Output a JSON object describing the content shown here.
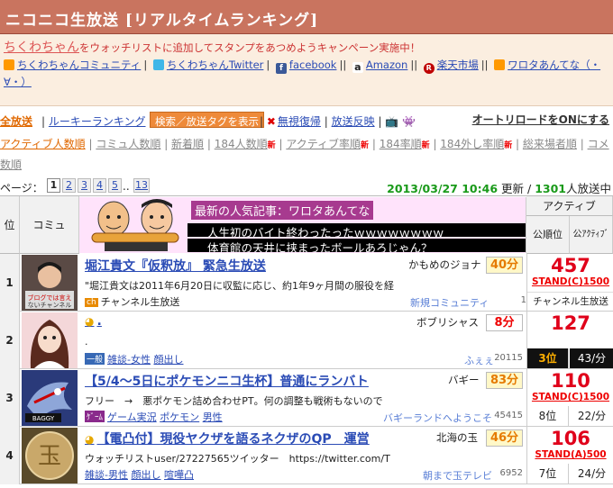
{
  "header": {
    "title": "ニコニコ生放送 [リアルタイムランキング]"
  },
  "promo": {
    "campaign_name": "ちくわちゃん",
    "campaign_text": "をウォッチリストに追加してスタンプをあつめようキャンペーン実施中！",
    "links": [
      "ちくわちゃんコミュニティ",
      "ちくわちゃんTwitter",
      "facebook",
      "Amazon",
      "楽天市場",
      "ワロタあんてな（・∀・）"
    ]
  },
  "nav": {
    "all": "全放送",
    "rookie": "ルーキーランキング",
    "tag_button": "検索／放送タグを表示",
    "ban_revive": "無視復帰",
    "reflect": "放送反映",
    "auto_reload": "オートリロードをONにする"
  },
  "sorts": [
    {
      "label": "アクティブ人数順",
      "new": false,
      "active": true
    },
    {
      "label": "コミュ人数順",
      "new": false,
      "active": false
    },
    {
      "label": "新着順",
      "new": false,
      "active": false
    },
    {
      "label": "184人数順",
      "new": true,
      "active": false
    },
    {
      "label": "アクティブ率順",
      "new": true,
      "active": false
    },
    {
      "label": "184率順",
      "new": true,
      "active": false
    },
    {
      "label": "184外し率順",
      "new": true,
      "active": false
    },
    {
      "label": "総来場者順",
      "new": false,
      "active": false
    },
    {
      "label": "コメ数順",
      "new": false,
      "active": false
    }
  ],
  "sort_new_badge": "新",
  "pager": {
    "label": "ページ：",
    "pages": [
      "1",
      "2",
      "3",
      "4",
      "5",
      "..",
      "13"
    ],
    "current": "1",
    "timestamp": "2013/03/27 10:46",
    "updated": "更新 /",
    "total": "1301",
    "total_suffix": "人放送中"
  },
  "table": {
    "col_rank": "位",
    "col_community": "コミュ",
    "col_active": "アクティブ",
    "col_public_rank": "公順位",
    "col_rate": "公ｱｸﾃｨﾌﾞ"
  },
  "banner": {
    "heading": "最新の人気記事：ワロタあんてな",
    "lines": [
      "人生初のバイト終わったったｗｗｗｗｗｗｗｗ",
      "体育館の天井に挟まったボールあろじゃん？"
    ]
  },
  "rows": [
    {
      "rank": "1",
      "title": "堀江貴文『仮釈放』 緊急生放送",
      "owner": "かもめのジョナ",
      "minutes": "40分",
      "desc": "\"堀江貴文は2011年6月20日に収監に応じ、約1年9ヶ月間の服役を経",
      "category_chip": "ch",
      "category": "チャンネル生放送",
      "tags": [],
      "community": "新規コミュニティ",
      "comm_count": "1",
      "count": "457",
      "stand": "STAND(C)1500",
      "sub": "チャンネル生放送",
      "public_rank": "",
      "rate": ""
    },
    {
      "rank": "2",
      "title": ".",
      "owner": "ボブリシャス",
      "minutes": "8分",
      "desc": ".",
      "category_chip": "一般",
      "category": "",
      "tags": [
        "雑談-女性",
        "顔出し"
      ],
      "community": "ふぇぇ",
      "comm_count": "20115",
      "count": "127",
      "stand": "",
      "sub": "",
      "public_rank": "3位",
      "rate": "43/分"
    },
    {
      "rank": "3",
      "title": "【5/4〜5日にポケモンニコ生杯】普通にランバト",
      "owner": "バギー",
      "minutes": "83分",
      "desc": "フリー　→　悪ポケモン詰め合わせPT。何の調整も戦術もないので",
      "category_chip": "ｹﾞｰﾑ",
      "category": "",
      "tags": [
        "ゲーム実況",
        "ポケモン",
        "男性"
      ],
      "community": "バギーランドへようこそ",
      "comm_count": "45415",
      "count": "110",
      "stand": "STAND(C)1500",
      "sub": "",
      "public_rank": "8位",
      "rate": "22/分"
    },
    {
      "rank": "4",
      "title": "【電凸付】現役ヤクザを語るネクザのQP　運営",
      "owner": "北海の玉",
      "minutes": "46分",
      "desc": "ウォッチリストuser/27227565ツイッター　https://twitter.com/T",
      "category_chip": "",
      "category": "",
      "tags": [
        "雑談-男性",
        "顔出し",
        "喧嘩凸"
      ],
      "community": "朝まで玉テレビ",
      "comm_count": "6952",
      "count": "106",
      "stand": "STAND(A)500",
      "sub": "",
      "public_rank": "7位",
      "rate": "24/分"
    }
  ]
}
